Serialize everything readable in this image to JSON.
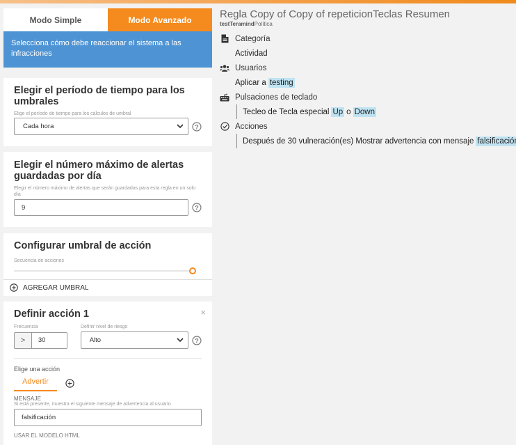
{
  "modes": {
    "simple": "Modo Simple",
    "advanced": "Modo Avanzado"
  },
  "info_text": "Selecciona cómo debe reaccionar el sistema a las infracciones",
  "period": {
    "title": "Elegir el período de tiempo para los umbrales",
    "hint": "Elige el período de tiempo para los cálculos de umbral",
    "value": "Cada hora"
  },
  "max_alerts": {
    "title": "Elegir el número máximo de alertas guardadas por día",
    "hint": "Elegir el número máximo de alertas que serán guardadas para esta regla en un solo día",
    "value": "9"
  },
  "threshold": {
    "title": "Configurar umbral de acción",
    "hint": "Secuencia de acciones",
    "slider_fraction": 1.0,
    "add_label": "AGREGAR UMBRAL"
  },
  "action": {
    "title": "Definir acción 1",
    "close": "×",
    "frequency_label": "Frecuencia",
    "risk_label": "Definir nivel de riesgo",
    "stepper_symbol": ">",
    "frequency_value": "30",
    "risk_value": "Alto",
    "choose_label": "Elige una acción",
    "action_tab": "Advertir",
    "message_label": "MENSAJE",
    "message_hint": "Si está presente, muestra el siguiente mensaje de advertencia al usuario",
    "message_value": "falsificación",
    "html_label": "USAR EL MODELO HTML"
  },
  "summary": {
    "title": "Regla Copy of Copy of repeticionTeclas Resumen",
    "owner": "testTeramind",
    "policy": "Política",
    "category_head": "Categoría",
    "category_value": "Actividad",
    "users_head": "Usuarios",
    "apply_to": "Aplicar a",
    "apply_target": "testing",
    "keystrokes_head": "Pulsaciones de teclado",
    "keystroke_text": "Tecleo de Tecla especial",
    "key_a": "Up",
    "key_or": "o",
    "key_b": "Down",
    "actions_head": "Acciones",
    "action_text": "Después de 30 vulneración(es) Mostrar advertencia con mensaje",
    "action_msg": "falsificación"
  },
  "colors": {
    "accent": "#f58b1f",
    "info": "#4e93d3",
    "highlight": "#bfe3f2"
  }
}
